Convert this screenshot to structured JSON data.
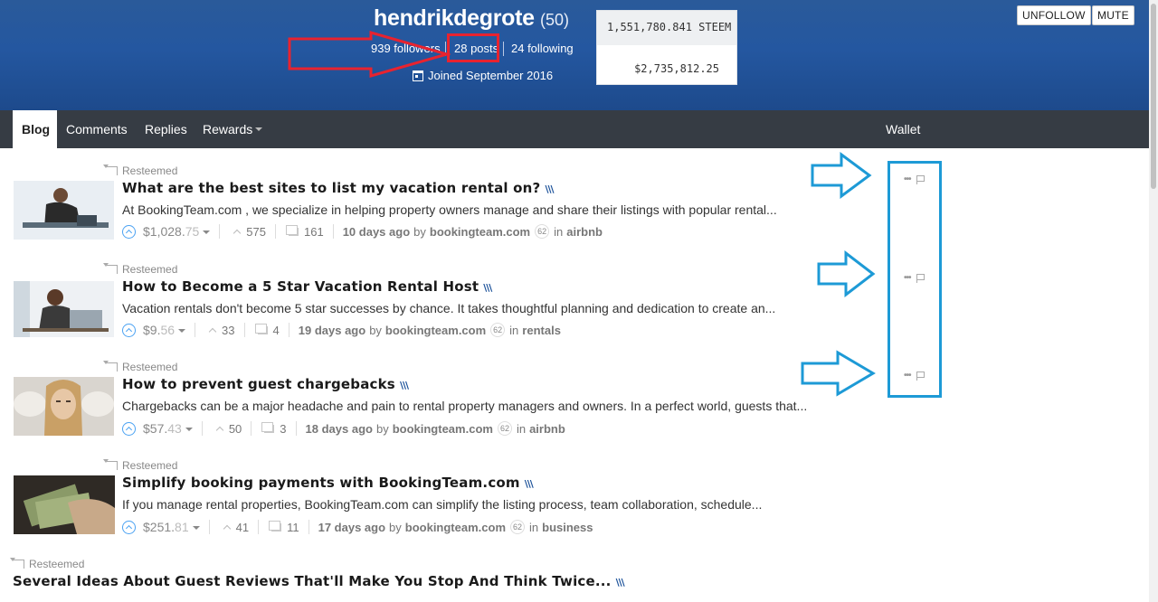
{
  "profile": {
    "username": "hendrikdegrote",
    "reputation": "(50)",
    "followers": "939 followers",
    "posts": "28 posts",
    "following": "24 following",
    "joined": "Joined September 2016",
    "steem_balance": "1,551,780.841 STEEM",
    "usd_value": "$2,735,812.25",
    "unfollow_label": "Unfollow",
    "mute_label": "Mute"
  },
  "nav": {
    "tabs": [
      {
        "label": "Blog",
        "active": true
      },
      {
        "label": "Comments"
      },
      {
        "label": "Replies"
      },
      {
        "label": "Rewards"
      }
    ],
    "wallet_label": "Wallet"
  },
  "posts": [
    {
      "resteemed": "Resteemed",
      "title": "What are the best sites to list my vacation rental on?",
      "excerpt": "At BookingTeam.com , we specialize in helping property owners manage and share their listings with popular rental...",
      "payout_main": "$1,028.",
      "payout_cents": "75",
      "votes": "575",
      "comments": "161",
      "time": "10 days ago",
      "by": "by",
      "author": "bookingteam.com",
      "author_rep": "62",
      "in": "in",
      "category": "airbnb"
    },
    {
      "resteemed": "Resteemed",
      "title": "How to Become a 5 Star Vacation Rental Host",
      "excerpt": "Vacation rentals don't become 5 star successes by chance. It takes thoughtful planning and dedication to create an...",
      "payout_main": "$9.",
      "payout_cents": "56",
      "votes": "33",
      "comments": "4",
      "time": "19 days ago",
      "by": "by",
      "author": "bookingteam.com",
      "author_rep": "62",
      "in": "in",
      "category": "rentals"
    },
    {
      "resteemed": "Resteemed",
      "title": "How to prevent guest chargebacks",
      "excerpt": "Chargebacks can be a major headache and pain to rental property managers and owners. In a perfect world, guests that...",
      "payout_main": "$57.",
      "payout_cents": "43",
      "votes": "50",
      "comments": "3",
      "time": "18 days ago",
      "by": "by",
      "author": "bookingteam.com",
      "author_rep": "62",
      "in": "in",
      "category": "airbnb"
    },
    {
      "resteemed": "Resteemed",
      "title": "Simplify booking payments with BookingTeam.com",
      "excerpt": "If you manage rental properties, BookingTeam.com can simplify the listing process, team collaboration, schedule...",
      "payout_main": "$251.",
      "payout_cents": "81",
      "votes": "41",
      "comments": "11",
      "time": "17 days ago",
      "by": "by",
      "author": "bookingteam.com",
      "author_rep": "62",
      "in": "in",
      "category": "business"
    },
    {
      "resteemed": "Resteemed",
      "title": "Several Ideas About Guest Reviews That'll Make You Stop And Think Twice..."
    }
  ],
  "colors": {
    "banner": "#2457a0",
    "nav": "#363c44",
    "annotation_red": "#e8232f",
    "annotation_blue": "#1d9ad6",
    "upvote": "#4ba2f2"
  }
}
